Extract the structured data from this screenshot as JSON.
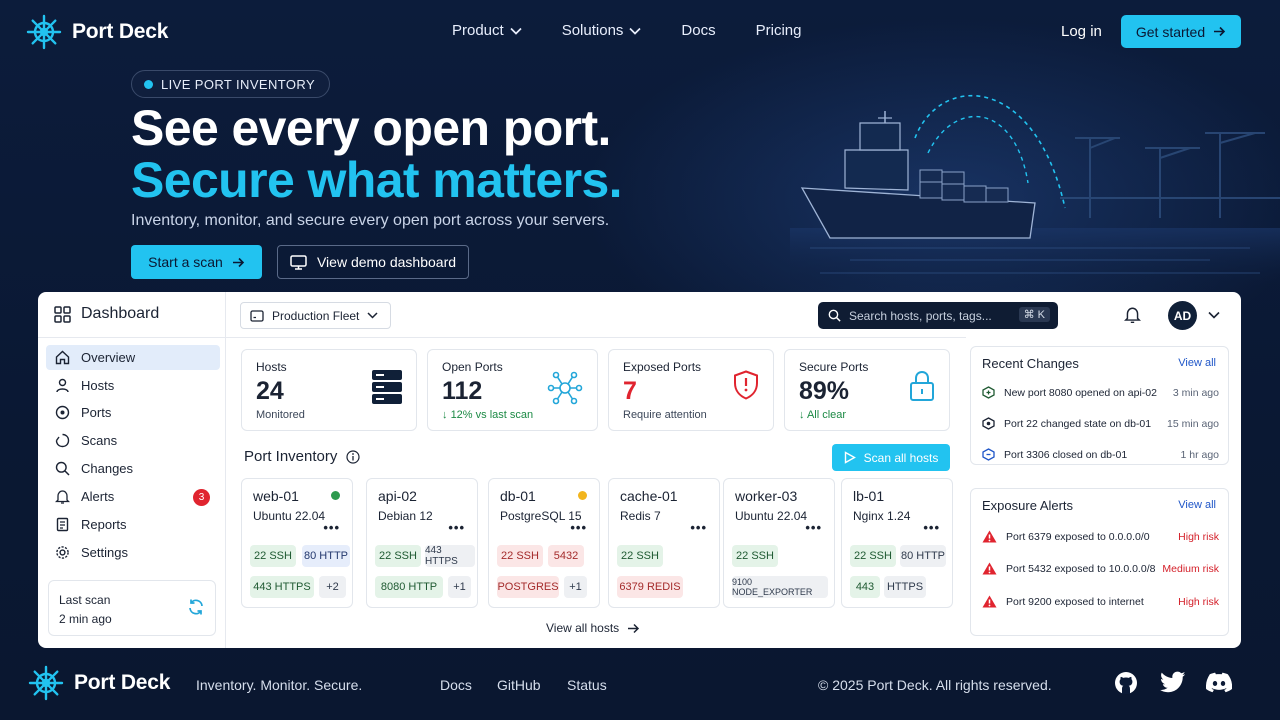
{
  "brand": {
    "name": "Port Deck"
  },
  "nav": {
    "links": [
      {
        "label": "Product",
        "has_menu": true
      },
      {
        "label": "Solutions",
        "has_menu": true
      },
      {
        "label": "Docs",
        "has_menu": false
      },
      {
        "label": "Pricing",
        "has_menu": false
      }
    ],
    "login_label": "Log in",
    "cta_label": "Get started"
  },
  "hero": {
    "pill": "LIVE PORT INVENTORY",
    "headline_1": "See every open port.",
    "headline_2": "Secure what matters.",
    "subtitle": "Inventory, monitor, and secure every open port across your servers.",
    "primary_button": "Start a scan",
    "secondary_button": "View demo dashboard"
  },
  "dashboard": {
    "title": "Dashboard",
    "fleet_label": "Production Fleet",
    "search_placeholder": "Search hosts, ports, tags...",
    "search_shortcut": "⌘ K",
    "avatar_initials": "AD",
    "sidebar": [
      {
        "label": "Overview",
        "icon": "home-icon",
        "active": true
      },
      {
        "label": "Hosts",
        "icon": "user-icon"
      },
      {
        "label": "Ports",
        "icon": "port-icon"
      },
      {
        "label": "Scans",
        "icon": "scan-icon"
      },
      {
        "label": "Changes",
        "icon": "search-icon"
      },
      {
        "label": "Alerts",
        "icon": "bell-icon",
        "badge": "3"
      },
      {
        "label": "Reports",
        "icon": "document-icon"
      },
      {
        "label": "Settings",
        "icon": "gear-icon"
      }
    ],
    "last_scan": {
      "label": "Last scan",
      "value": "2 min ago"
    },
    "stats": [
      {
        "label": "Hosts",
        "value": "24",
        "sub": "Monitored",
        "icon": "server-icon"
      },
      {
        "label": "Open Ports",
        "value": "112",
        "sub": "12% vs last scan",
        "icon": "network-icon"
      },
      {
        "label": "Exposed Ports",
        "value": "7",
        "sub": "Require attention",
        "icon": "shield-alert-icon"
      },
      {
        "label": "Secure Ports",
        "value": "89%",
        "sub": "All clear",
        "icon": "lock-icon"
      }
    ],
    "port_inventory": {
      "title": "Port Inventory",
      "scan_all_label": "Scan all hosts",
      "view_all_label": "View all hosts",
      "hosts": [
        {
          "name": "web-01",
          "os": "Ubuntu 22.04",
          "status": "green",
          "tags": [
            {
              "t": "22 SSH",
              "c": "g"
            },
            {
              "t": "80 HTTP",
              "c": "b"
            },
            {
              "t": "443 HTTPS",
              "c": "g"
            },
            {
              "t": "+2",
              "c": "n"
            }
          ]
        },
        {
          "name": "api-02",
          "os": "Debian 12",
          "status": "",
          "tags": [
            {
              "t": "22 SSH",
              "c": "g"
            },
            {
              "t": "443 HTTPS",
              "c": "n"
            },
            {
              "t": "8080 HTTP",
              "c": "g"
            },
            {
              "t": "+1",
              "c": "n"
            }
          ]
        },
        {
          "name": "db-01",
          "os": "PostgreSQL 15",
          "status": "amber",
          "tags": [
            {
              "t": "22 SSH",
              "c": "r"
            },
            {
              "t": "5432",
              "c": "r"
            },
            {
              "t": "POSTGRES",
              "c": "r"
            },
            {
              "t": "+1",
              "c": "n"
            }
          ]
        },
        {
          "name": "cache-01",
          "os": "Redis 7",
          "status": "",
          "tags": [
            {
              "t": "22 SSH",
              "c": "g"
            },
            {
              "t": "6379 REDIS",
              "c": "r"
            }
          ]
        },
        {
          "name": "worker-03",
          "os": "Ubuntu 22.04",
          "status": "",
          "tags": [
            {
              "t": "22 SSH",
              "c": "g"
            },
            {
              "t": "9100 NODE_EXPORTER",
              "c": "n"
            }
          ]
        },
        {
          "name": "lb-01",
          "os": "Nginx 1.24",
          "status": "",
          "tags": [
            {
              "t": "22 SSH",
              "c": "g"
            },
            {
              "t": "80 HTTP",
              "c": "n"
            },
            {
              "t": "443",
              "c": "g"
            },
            {
              "t": "HTTPS",
              "c": "n"
            }
          ]
        }
      ]
    },
    "recent_changes": {
      "title": "Recent Changes",
      "view_all": "View all",
      "items": [
        {
          "text": "New port 8080 opened on api-02",
          "time": "3 min ago"
        },
        {
          "text": "Port 22 changed state on db-01",
          "time": "15 min ago"
        },
        {
          "text": "Port 3306 closed on db-01",
          "time": "1 hr ago"
        }
      ]
    },
    "exposure_alerts": {
      "title": "Exposure Alerts",
      "view_all": "View all",
      "items": [
        {
          "text": "Port 6379 exposed to 0.0.0.0/0",
          "risk": "High risk"
        },
        {
          "text": "Port 5432 exposed to 10.0.0.0/8",
          "risk": "Medium risk"
        },
        {
          "text": "Port 9200 exposed to internet",
          "risk": "High risk"
        }
      ]
    }
  },
  "footer": {
    "tagline": "Inventory. Monitor. Secure.",
    "links": [
      "Docs",
      "GitHub",
      "Status"
    ],
    "copyright": "© 2025 Port Deck. All rights reserved.",
    "social": [
      "github-icon",
      "twitter-icon",
      "discord-icon"
    ]
  },
  "colors": {
    "accent": "#22c3f0",
    "background": "#0b1a36",
    "danger": "#e0242f",
    "success": "#1c8a45",
    "link": "#1f56c8"
  }
}
